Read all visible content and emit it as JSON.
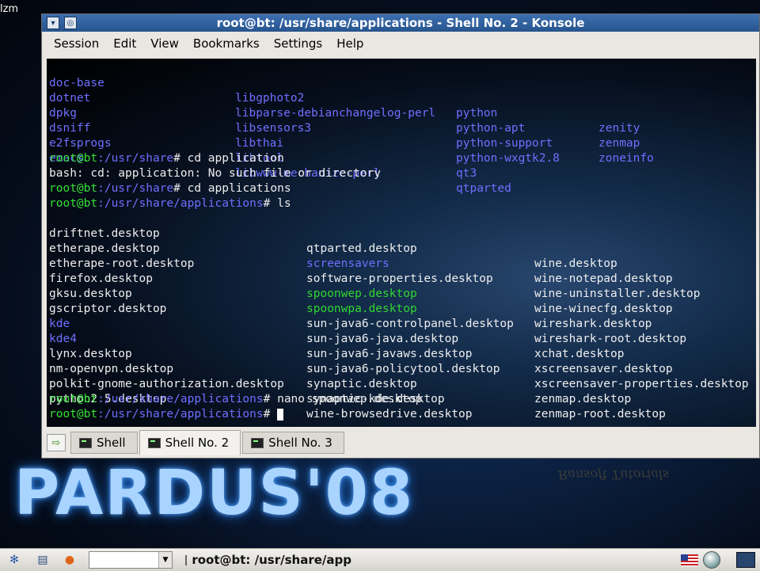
{
  "desktop": {
    "top_label": "lzm",
    "brand": "PARDUS'08",
    "watermark": "Ransoft Tutorials"
  },
  "window": {
    "title": "root@bt: /usr/share/applications - Shell No. 2 - Konsole",
    "menu": [
      "Session",
      "Edit",
      "View",
      "Bookmarks",
      "Settings",
      "Help"
    ]
  },
  "terminal": {
    "top_listing": [
      [
        "doc-base",
        "libgphoto2",
        "python",
        "zenity"
      ],
      [
        "dotnet",
        "libparse-debianchangelog-perl",
        "python-apt",
        "zenmap"
      ],
      [
        "dpkg",
        "libsensors3",
        "python-support",
        "zoneinfo"
      ],
      [
        "dsniff",
        "libthai",
        "python-wxgtk2.8",
        ""
      ],
      [
        "e2fsprogs",
        "libtool",
        "qt3",
        ""
      ],
      [
        "emacs",
        "libwww-mechanize-perl",
        "qtparted",
        ""
      ]
    ],
    "prompt_user": "root@bt",
    "path_share": ":/usr/share",
    "path_apps": ":/usr/share/applications",
    "cmd1": "# cd application",
    "error": "bash: cd: application: No such file or directory",
    "cmd2": "# cd applications",
    "cmd3": "# ls",
    "ls_listing": [
      [
        "driftnet.desktop",
        "qtparted.desktop",
        "wine.desktop"
      ],
      [
        "etherape.desktop",
        "screensavers",
        "wine-notepad.desktop"
      ],
      [
        "etherape-root.desktop",
        "software-properties.desktop",
        "wine-uninstaller.desktop"
      ],
      [
        "firefox.desktop",
        "spoonwep.desktop",
        "wine-winecfg.desktop"
      ],
      [
        "gksu.desktop",
        "spoonwpa.desktop",
        "wireshark.desktop"
      ],
      [
        "gscriptor.desktop",
        "sun-java6-controlpanel.desktop",
        "wireshark-root.desktop"
      ],
      [
        "kde",
        "sun-java6-java.desktop",
        "xchat.desktop"
      ],
      [
        "kde4",
        "sun-java6-javaws.desktop",
        "xscreensaver.desktop"
      ],
      [
        "lynx.desktop",
        "sun-java6-policytool.desktop",
        "xscreensaver-properties.desktop"
      ],
      [
        "nm-openvpn.desktop",
        "synaptic.desktop",
        "zenmap.desktop"
      ],
      [
        "polkit-gnome-authorization.desktop",
        "synaptic-kde.desktop",
        "zenmap-root.desktop"
      ],
      [
        "python2.5.desktop",
        "wine-browsedrive.desktop",
        ""
      ]
    ],
    "cmd4": "# nano spoonwep.desktop",
    "cmd5": "# "
  },
  "tabs": [
    {
      "label": "Shell"
    },
    {
      "label": "Shell No. 2"
    },
    {
      "label": "Shell No. 3"
    }
  ],
  "taskbar": {
    "task_label": "root@bt: /usr/share/app"
  },
  "colors": {
    "dir_blue": "#6f6fff",
    "exec_green": "#31d631",
    "title_blue": "#3d70b2"
  }
}
